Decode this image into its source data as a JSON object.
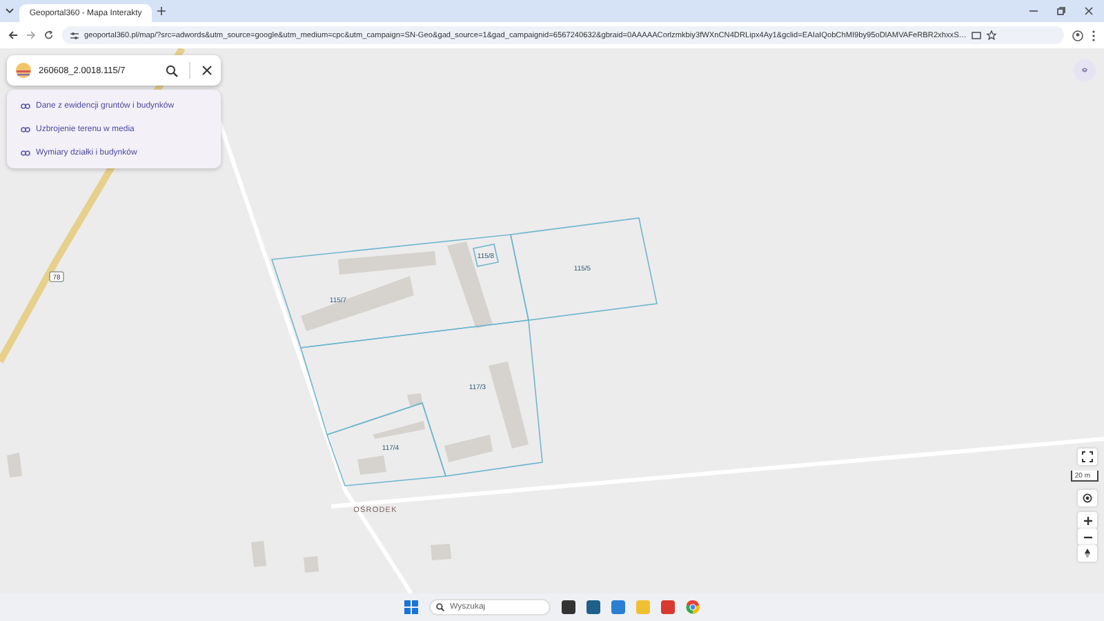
{
  "browser": {
    "tab_title": "Geoportal360 - Mapa Interakty",
    "url": "geoportal360.pl/map/?src=adwords&utm_source=google&utm_medium=cpc&utm_campaign=SN-Geo&gad_source=1&gad_campaignid=6567240632&gbraid=0AAAAACorlzmkbiy3fWXnCN4DRLipx4Ay1&gclid=EAIaIQobChMI9by95oDlAMVAFeRBR2xhxxS…"
  },
  "search": {
    "value": "260608_2.0018.115/7"
  },
  "links": [
    "Dane z ewidencji gruntów i budynków",
    "Uzbrojenie terenu w media",
    "Wymiary działki i budynków"
  ],
  "map": {
    "parcels": [
      "115/7",
      "115/8",
      "115/5",
      "117/3",
      "117/4"
    ],
    "road_number": "78",
    "place_name": "OŚRODEK",
    "scale": "20 m"
  },
  "taskbar": {
    "search_placeholder": "Wyszukaj"
  }
}
